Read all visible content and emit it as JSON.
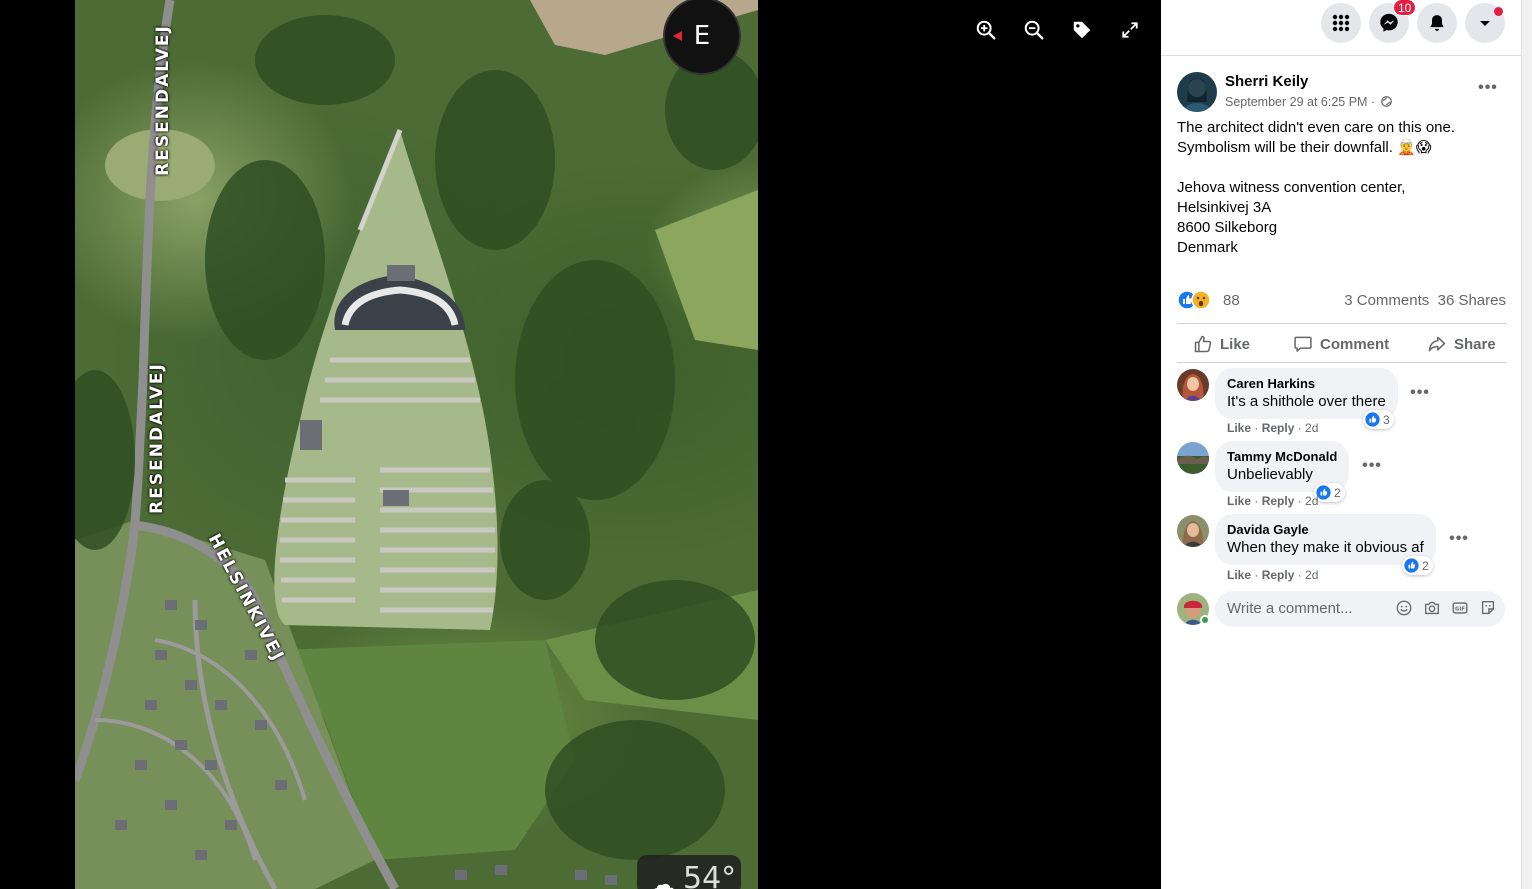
{
  "photo": {
    "road_labels": [
      "RESENDALVEJ",
      "RESENDALVEJ",
      "HELSINKIVEJ"
    ],
    "compass_letter": "E",
    "weather_temp": "54°",
    "weather_icon": "cloud-icon"
  },
  "viewer_tools": [
    "zoom-in-icon",
    "zoom-out-icon",
    "tag-icon",
    "fullscreen-icon"
  ],
  "topbar": {
    "messenger_badge": "10",
    "buttons": [
      "menu-grid-icon",
      "messenger-icon",
      "notifications-icon",
      "account-dropdown-icon"
    ]
  },
  "post": {
    "author": "Sherri Keily",
    "time": "September 29 at 6:25 PM ·",
    "audience_icon": "globe-icon",
    "text_lines": [
      "The architect didn't even care on this one.",
      "Symbolism will be their downfall. 🧝😱",
      "",
      "Jehova witness convention center,",
      "Helsinkivej 3A",
      "8600 Silkeborg",
      "Denmark"
    ],
    "reaction_count": "88",
    "comments_count": "3 Comments",
    "shares_count": "36 Shares"
  },
  "actions": {
    "like": "Like",
    "comment": "Comment",
    "share": "Share"
  },
  "comments": [
    {
      "name": "Caren Harkins",
      "text": "It's a shithole over there",
      "likes": "3",
      "like": "Like",
      "reply": "Reply",
      "age": "2d"
    },
    {
      "name": "Tammy McDonald",
      "text": "Unbelievably",
      "likes": "2",
      "like": "Like",
      "reply": "Reply",
      "age": "2d"
    },
    {
      "name": "Davida Gayle",
      "text": "When they make it obvious af",
      "likes": "2",
      "like": "Like",
      "reply": "Reply",
      "age": "2d"
    }
  ],
  "composer": {
    "placeholder": "Write a comment...",
    "icons": [
      "emoji-icon",
      "camera-icon",
      "gif-icon",
      "sticker-icon"
    ]
  },
  "colors": {
    "facebook_blue": "#1877f2",
    "badge_red": "#e41e3f",
    "secondary_text": "#65676b"
  }
}
